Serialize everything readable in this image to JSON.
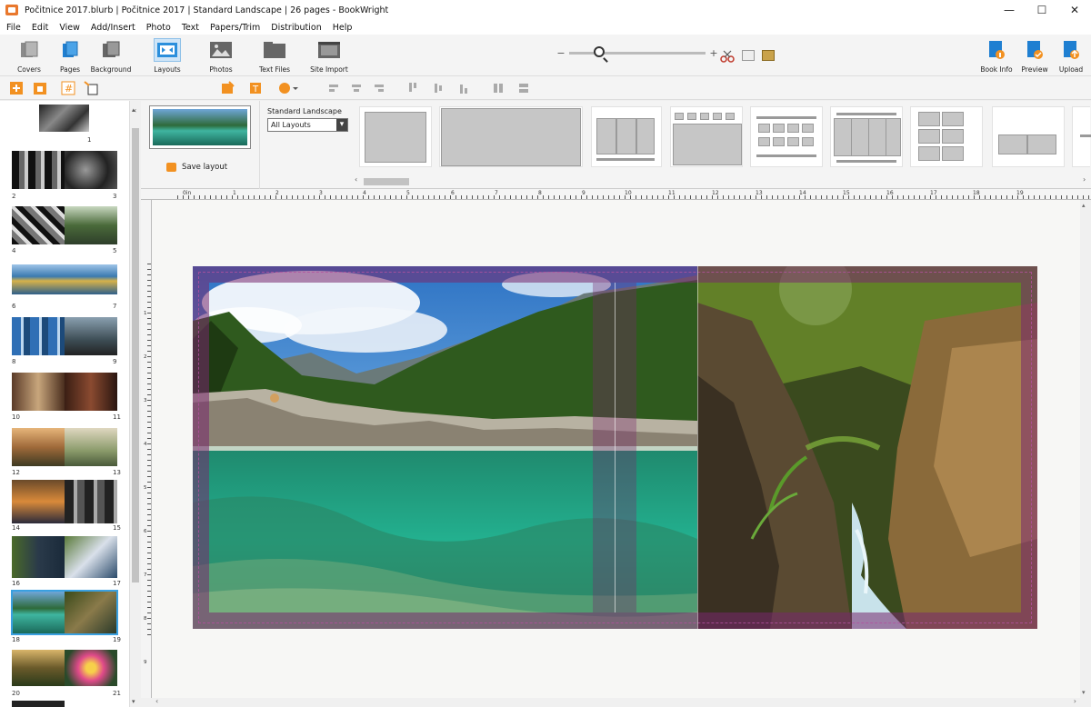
{
  "window": {
    "title": "Počitnice 2017.blurb | Počitnice 2017 | Standard Landscape | 26 pages - BookWright",
    "minimize": "—",
    "maximize": "☐",
    "close": "✕"
  },
  "menu": [
    "File",
    "Edit",
    "View",
    "Add/Insert",
    "Photo",
    "Text",
    "Papers/Trim",
    "Distribution",
    "Help"
  ],
  "toolbar": {
    "covers": "Covers",
    "pages": "Pages",
    "background": "Background",
    "layouts": "Layouts",
    "photos": "Photos",
    "text_files": "Text Files",
    "site_import": "Site Import",
    "book_info": "Book Info",
    "preview": "Preview",
    "upload": "Upload"
  },
  "zoom": {
    "minus": "−",
    "plus": "+",
    "level": 0.22
  },
  "page_panel": {
    "thumbs": [
      {
        "label": "1"
      },
      {
        "left": "2",
        "right": "3"
      },
      {
        "left": "4",
        "right": "5"
      },
      {
        "left": "6",
        "right": "7"
      },
      {
        "left": "8",
        "right": "9"
      },
      {
        "left": "10",
        "right": "11"
      },
      {
        "left": "12",
        "right": "13"
      },
      {
        "left": "14",
        "right": "15"
      },
      {
        "left": "16",
        "right": "17"
      },
      {
        "left": "18",
        "right": "19"
      },
      {
        "left": "20",
        "right": "21"
      }
    ]
  },
  "layouts_panel": {
    "save_layout": "Save layout",
    "select_title": "Standard Landscape",
    "select_value": "All Layouts"
  },
  "ruler": {
    "labels": [
      "0in",
      "1",
      "2",
      "3",
      "4",
      "5",
      "6",
      "7",
      "8",
      "9",
      "10",
      "11",
      "12",
      "13",
      "14",
      "15",
      "16",
      "17",
      "18",
      "19"
    ],
    "vlabels": [
      "1",
      "2",
      "3",
      "4",
      "5",
      "6",
      "7",
      "8",
      "9"
    ]
  },
  "colors": {
    "accent_orange": "#f29121",
    "accent_blue": "#1f7fd1",
    "bleed_purple": "#78286e"
  }
}
